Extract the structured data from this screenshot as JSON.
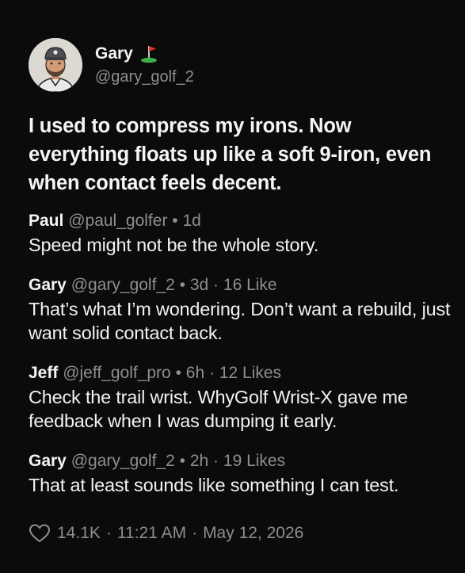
{
  "author": {
    "name": "Gary",
    "handle": "@gary_golf_2",
    "badge_icon": "golf-flag-icon"
  },
  "post": {
    "text": "I used to compress my irons. Now everything floats up like a soft 9-iron, even when contact feels decent."
  },
  "replies": [
    {
      "author": "Paul",
      "handle": "@paul_golfer",
      "time": "1d",
      "likes": "",
      "text": "Speed might not be the whole story."
    },
    {
      "author": "Gary",
      "handle": "@gary_golf_2",
      "time": "3d",
      "likes": "16 Like",
      "text": "That’s what I’m wondering. Don’t want a rebuild, just want solid contact back."
    },
    {
      "author": "Jeff",
      "handle": "@jeff_golf_pro",
      "time": "6h",
      "likes": "12 Likes",
      "text": "Check the trail wrist. WhyGolf Wrist-X gave me feedback when I was dumping it early."
    },
    {
      "author": "Gary",
      "handle": "@gary_golf_2",
      "time": "2h",
      "likes": "19 Likes",
      "text": "That at least sounds like something I can test."
    }
  ],
  "footer": {
    "like_icon": "heart-icon",
    "like_count": "14.1K",
    "time": "11:21 AM",
    "date": "May 12, 2026"
  },
  "colors": {
    "background": "#0b0b0b",
    "text": "#f2f2f2",
    "muted": "#8e8e93",
    "flag_red": "#e0332f",
    "flag_green": "#3fae49"
  }
}
